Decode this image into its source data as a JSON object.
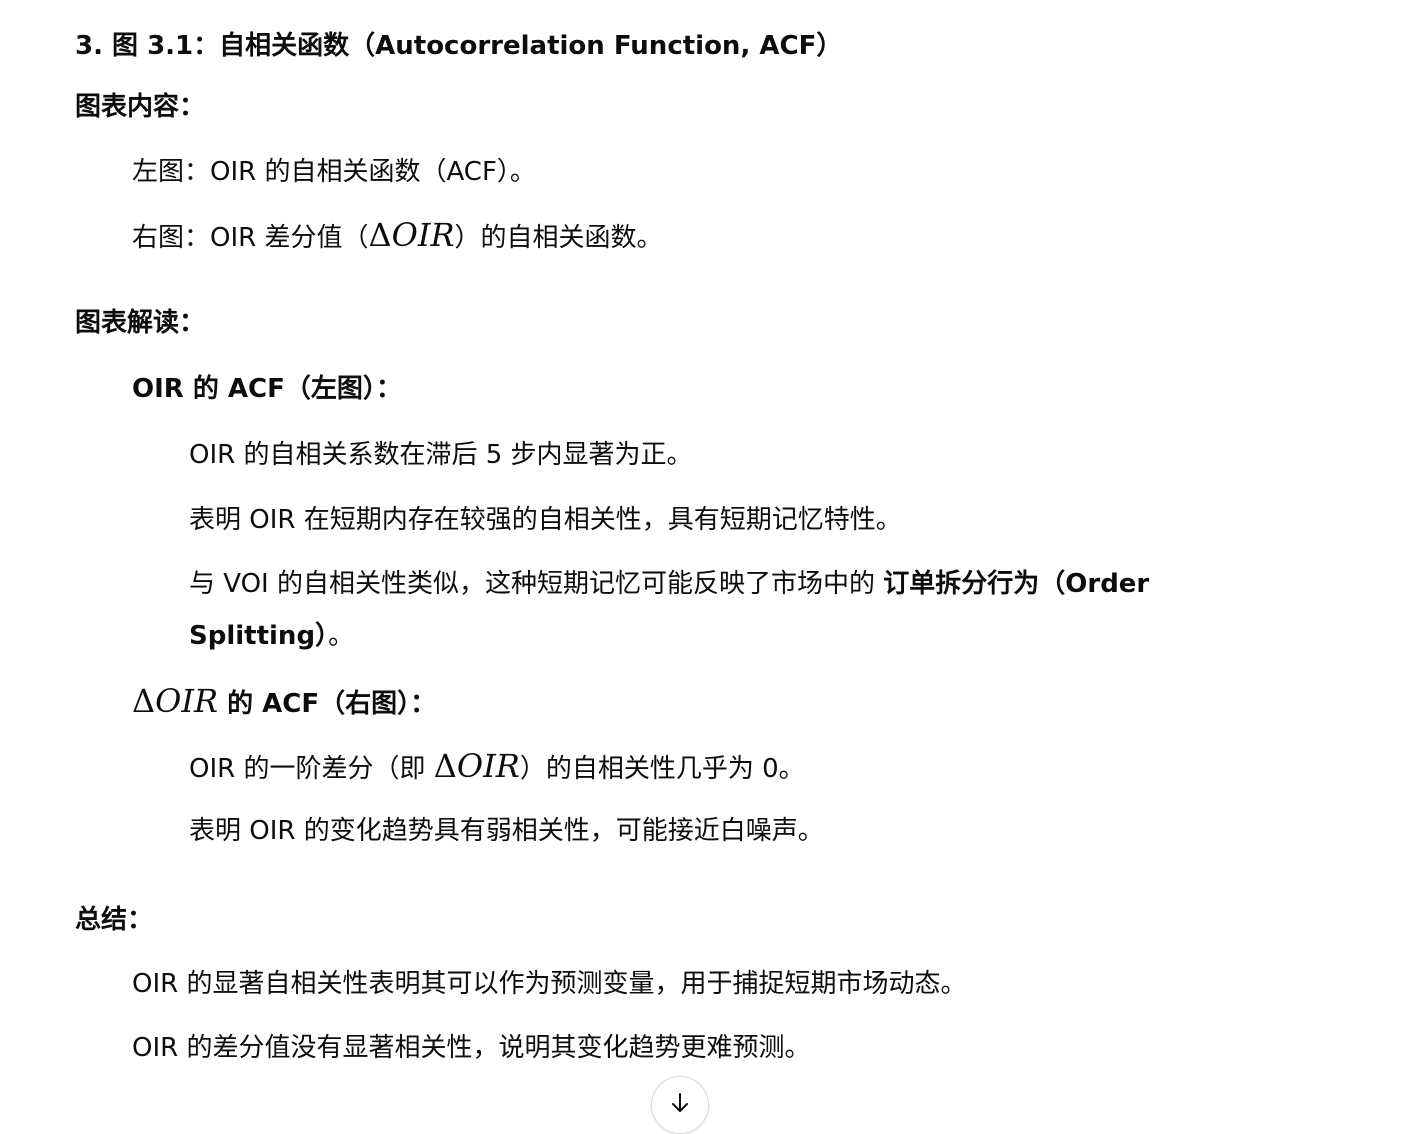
{
  "section": {
    "heading": "3. 图 3.1：自相关函数（Autocorrelation Function, ACF）",
    "content": {
      "label": "图表内容：",
      "left": "左图：OIR 的自相关函数（ACF）。",
      "right_pre": "右图：OIR 差分值（",
      "right_post": "）的自相关函数。"
    },
    "reading": {
      "label": "图表解读：",
      "oir": {
        "title": "OIR 的 ACF（左图）：",
        "p1": "OIR 的自相关系数在滞后 5 步内显著为正。",
        "p2": "表明 OIR 在短期内存在较强的自相关性，具有短期记忆特性。",
        "p3_pre": "与 VOI 的自相关性类似，这种短期记忆可能反映了市场中的 ",
        "p3_bold_1": "订单拆分行为（Order",
        "p3_bold_2": "Splitting）",
        "p3_end": "。"
      },
      "doir": {
        "title_post": " 的 ACF（右图）：",
        "p1_pre": "OIR 的一阶差分（即 ",
        "p1_post": "）的自相关性几乎为 0。",
        "p2": "表明 OIR 的变化趋势具有弱相关性，可能接近白噪声。"
      }
    },
    "summary": {
      "label": "总结：",
      "p1": "OIR 的显著自相关性表明其可以作为预测变量，用于捕捉短期市场动态。",
      "p2": "OIR 的差分值没有显著相关性，说明其变化趋势更难预测。"
    },
    "math": {
      "delta": "Δ",
      "var": "OIR"
    }
  },
  "icons": {
    "scroll_down": "arrow-down-icon"
  }
}
